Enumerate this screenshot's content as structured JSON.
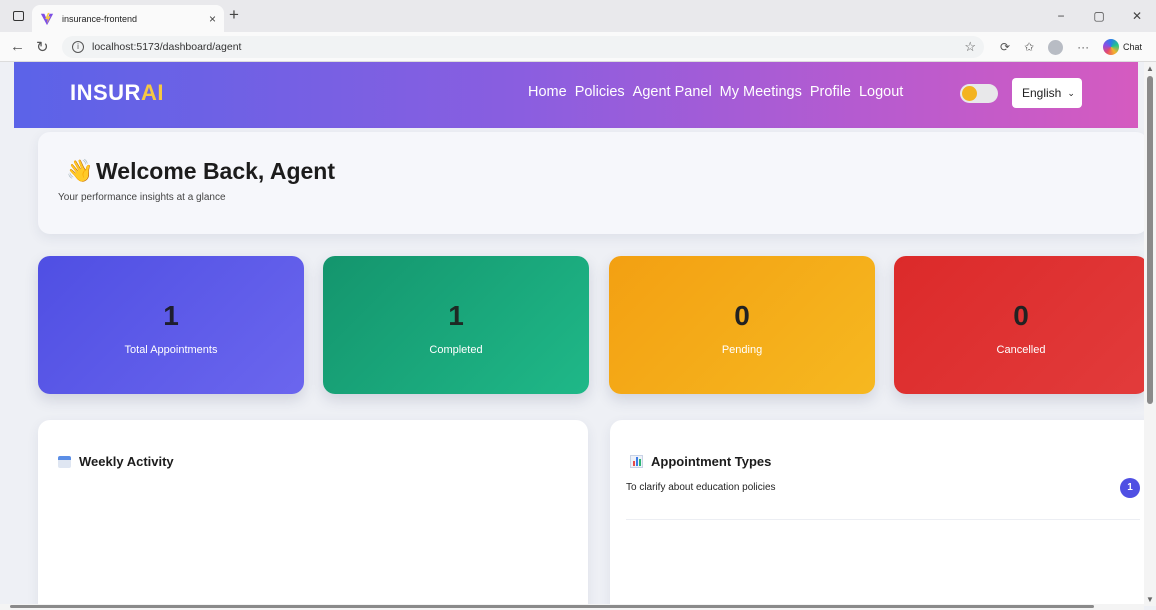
{
  "browser": {
    "tab_title": "insurance-frontend",
    "tab_close": "×",
    "new_tab": "+",
    "url": "localhost:5173/dashboard/agent",
    "chat_label": "Chat",
    "window_controls": [
      "−",
      "▢",
      "✕"
    ]
  },
  "navbar": {
    "brand_main": "INSUR",
    "brand_accent": "AI",
    "links": [
      "Home",
      "Policies",
      "Agent Panel",
      "My Meetings",
      "Profile",
      "Logout"
    ],
    "language": "English",
    "accent_color": "#f6c843"
  },
  "welcome": {
    "emoji": "👋",
    "title": "Welcome Back, Agent",
    "subtitle": "Your performance insights at a glance"
  },
  "stats": [
    {
      "value": "1",
      "label": "Total Appointments",
      "color": "#4f4fe3"
    },
    {
      "value": "1",
      "label": "Completed",
      "color": "#14956d"
    },
    {
      "value": "0",
      "label": "Pending",
      "color": "#f3a012"
    },
    {
      "value": "0",
      "label": "Cancelled",
      "color": "#dc2a2a"
    }
  ],
  "weekly_activity": {
    "title": "Weekly Activity",
    "icon": "calendar-icon"
  },
  "appointment_types": {
    "title": "Appointment Types",
    "icon": "bar-chart-icon",
    "items": [
      {
        "label": "To clarify about education policies",
        "count": "1"
      }
    ]
  }
}
